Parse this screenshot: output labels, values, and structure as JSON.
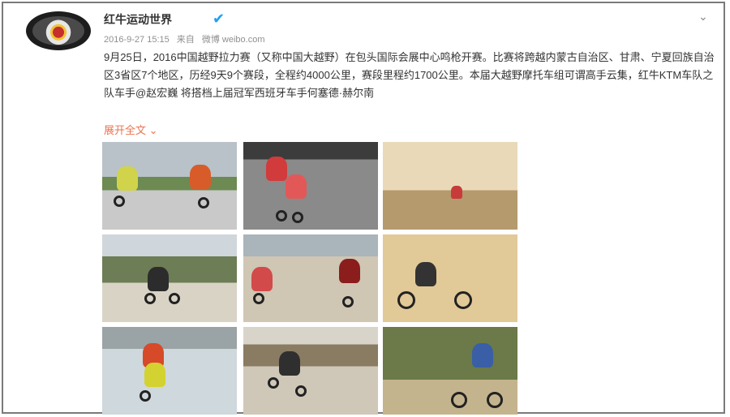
{
  "post": {
    "author": "红牛运动世界",
    "verified_icon": "verified-badge-icon",
    "timestamp": "2016-9-27 15:15",
    "source_prefix": "来自",
    "source": "微博 weibo.com",
    "text": "9月25日，2016中国越野拉力赛（又称中国大越野）在包头国际会展中心鸣枪开赛。比赛将跨越内蒙古自治区、甘肃、宁夏回族自治区3省区7个地区，历经9天9个赛段，全程约4000公里，赛段里程约1700公里。本届大越野摩托车组可谓高手云集，红牛KTM车队之队车手@赵宏巍 将搭档上届冠军西班牙车手何塞德·赫尔南",
    "expand_label": "展开全文",
    "expand_icon": "chevron-down-icon",
    "menu_icon": "chevron-down-icon"
  },
  "images": [
    {
      "label": "photo-1"
    },
    {
      "label": "photo-2"
    },
    {
      "label": "photo-3"
    },
    {
      "label": "photo-4"
    },
    {
      "label": "photo-5"
    },
    {
      "label": "photo-6"
    },
    {
      "label": "photo-7"
    },
    {
      "label": "photo-8"
    },
    {
      "label": "photo-9"
    }
  ],
  "colors": {
    "accent": "#eb7350",
    "verified": "#1ea0f2"
  }
}
